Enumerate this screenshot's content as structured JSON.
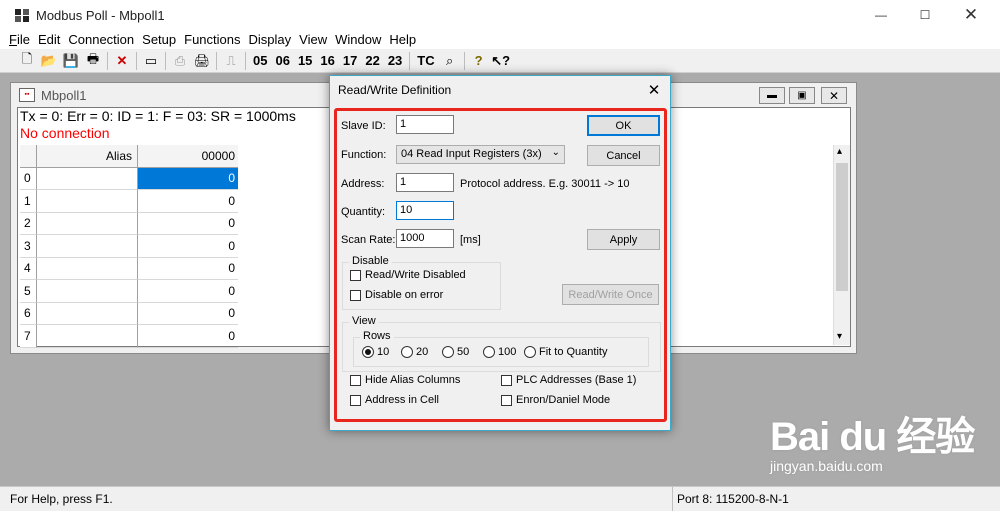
{
  "app": {
    "title": "Modbus Poll - Mbpoll1",
    "menu": [
      "File",
      "Edit",
      "Connection",
      "Setup",
      "Functions",
      "Display",
      "View",
      "Window",
      "Help"
    ],
    "menu_underline": [
      "F",
      "E",
      "C",
      "S",
      "F",
      "D",
      "V",
      "W",
      "H"
    ]
  },
  "toolbar": {
    "function_codes": [
      "05",
      "06",
      "15",
      "16",
      "17",
      "22",
      "23"
    ],
    "tc_label": "TC"
  },
  "mdi": {
    "title": "Mbpoll1",
    "status": "Tx = 0: Err = 0: ID = 1: F = 03: SR = 1000ms",
    "connection": "No connection",
    "columns": {
      "alias": "Alias",
      "address": "00000"
    },
    "rows": [
      {
        "n": "0",
        "v": "0"
      },
      {
        "n": "1",
        "v": "0"
      },
      {
        "n": "2",
        "v": "0"
      },
      {
        "n": "3",
        "v": "0"
      },
      {
        "n": "4",
        "v": "0"
      },
      {
        "n": "5",
        "v": "0"
      },
      {
        "n": "6",
        "v": "0"
      },
      {
        "n": "7",
        "v": "0"
      }
    ]
  },
  "dialog": {
    "title": "Read/Write Definition",
    "slave_id_label": "Slave ID:",
    "slave_id": "1",
    "function_label": "Function:",
    "function_value": "04 Read Input Registers (3x)",
    "address_label": "Address:",
    "address": "1",
    "address_hint": "Protocol address. E.g. 30011 -> 10",
    "quantity_label": "Quantity:",
    "quantity": "10",
    "scan_rate_label": "Scan Rate:",
    "scan_rate": "1000",
    "scan_rate_unit": "[ms]",
    "ok": "OK",
    "cancel": "Cancel",
    "apply": "Apply",
    "rw_once": "Read/Write Once",
    "disable_group": "Disable",
    "rw_disabled": "Read/Write Disabled",
    "disable_on_error": "Disable on error",
    "view_group": "View",
    "rows_group": "Rows",
    "rows_options": [
      "10",
      "20",
      "50",
      "100",
      "Fit to Quantity"
    ],
    "rows_selected": "10",
    "hide_alias": "Hide Alias Columns",
    "address_in_cell": "Address in Cell",
    "plc_addresses": "PLC Addresses (Base 1)",
    "enron_mode": "Enron/Daniel Mode"
  },
  "statusbar": {
    "help": "For Help, press F1.",
    "port": "Port 8: 115200-8-N-1"
  },
  "watermark": {
    "brand": "Bai du 经验",
    "url": "jingyan.baidu.com"
  },
  "colors": {
    "highlight": "#e8261e",
    "selection": "#0078d7",
    "error_text": "#ff0000"
  }
}
